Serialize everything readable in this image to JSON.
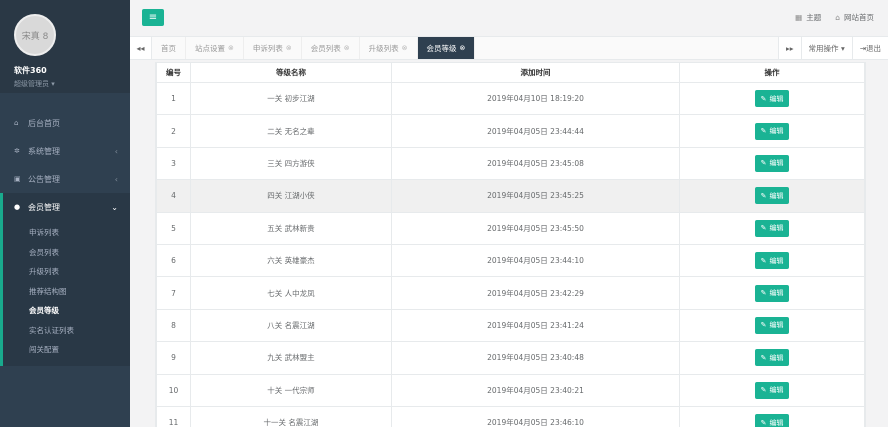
{
  "sidebar": {
    "avatar_text": "宋真 8",
    "user_name": "软件360",
    "user_role": "超级管理员",
    "items": [
      {
        "label": "后台首页",
        "icon": "home-icon"
      },
      {
        "label": "系统管理",
        "icon": "gear-icon"
      },
      {
        "label": "公告管理",
        "icon": "copy-icon"
      },
      {
        "label": "会员管理",
        "icon": "user-icon"
      }
    ],
    "subitems": [
      "申诉列表",
      "会员列表",
      "升级列表",
      "推荐结构图",
      "会员等级",
      "实名认证列表",
      "闯关配置"
    ]
  },
  "topbar": {
    "theme_label": "主题",
    "site_home_label": "网站首页"
  },
  "tabs": {
    "items": [
      "首页",
      "站点设置",
      "申诉列表",
      "会员列表",
      "升级列表",
      "会员等级"
    ],
    "ops_label": "常用操作",
    "exit_label": "退出"
  },
  "table": {
    "headers": [
      "编号",
      "等级名称",
      "添加时间",
      "操作"
    ],
    "edit_label": "编辑",
    "rows": [
      {
        "id": "1",
        "name": "一关 初步江湖",
        "time": "2019年04月10日 18:19:20"
      },
      {
        "id": "2",
        "name": "二关 无名之辈",
        "time": "2019年04月05日 23:44:44"
      },
      {
        "id": "3",
        "name": "三关 四方游侠",
        "time": "2019年04月05日 23:45:08"
      },
      {
        "id": "4",
        "name": "四关 江湖小侠",
        "time": "2019年04月05日 23:45:25"
      },
      {
        "id": "5",
        "name": "五关 武林新贵",
        "time": "2019年04月05日 23:45:50"
      },
      {
        "id": "6",
        "name": "六关 英雄豪杰",
        "time": "2019年04月05日 23:44:10"
      },
      {
        "id": "7",
        "name": "七关 人中龙凤",
        "time": "2019年04月05日 23:42:29"
      },
      {
        "id": "8",
        "name": "八关 名震江湖",
        "time": "2019年04月05日 23:41:24"
      },
      {
        "id": "9",
        "name": "九关 武林盟主",
        "time": "2019年04月05日 23:40:48"
      },
      {
        "id": "10",
        "name": "十关 一代宗师",
        "time": "2019年04月05日 23:40:21"
      },
      {
        "id": "11",
        "name": "十一关 名震江湖",
        "time": "2019年04月05日 23:46:10"
      }
    ]
  },
  "colors": {
    "accent": "#1ab394",
    "sidebar": "#2f4050"
  }
}
